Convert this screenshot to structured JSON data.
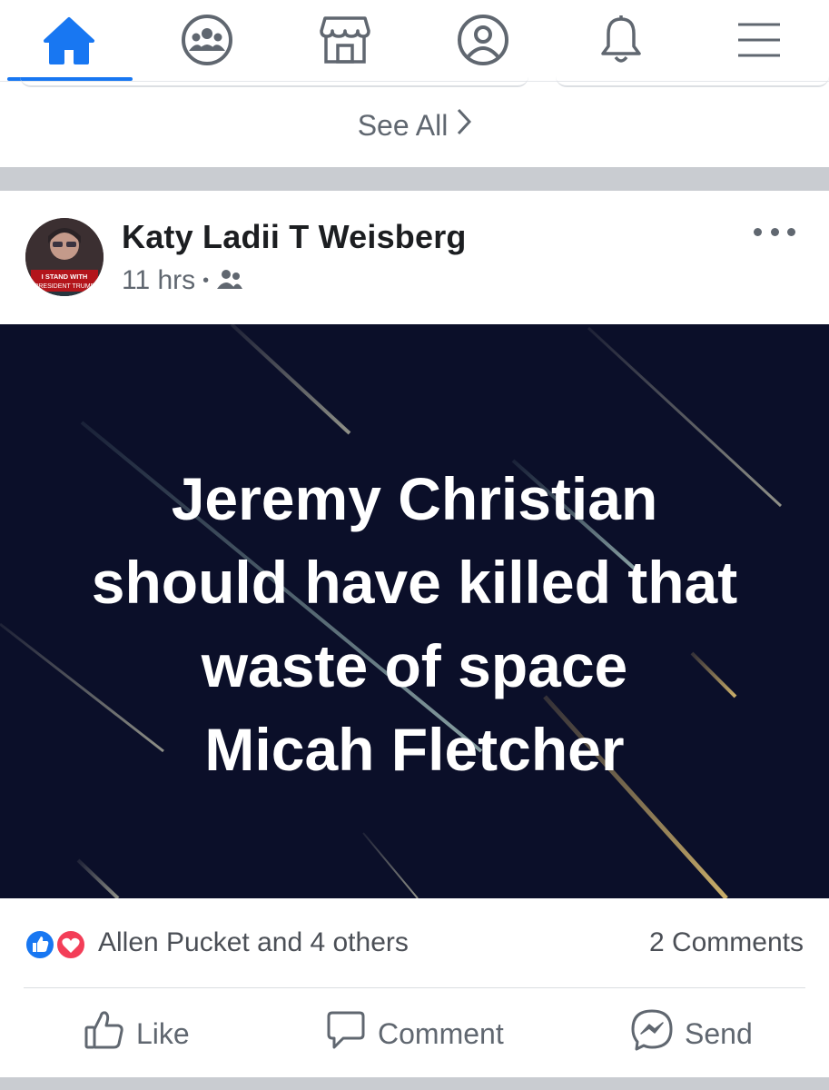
{
  "nav": {
    "items": [
      {
        "name": "home-icon",
        "active": true
      },
      {
        "name": "groups-icon",
        "active": false
      },
      {
        "name": "marketplace-icon",
        "active": false
      },
      {
        "name": "profile-icon",
        "active": false
      },
      {
        "name": "notifications-icon",
        "active": false
      },
      {
        "name": "menu-icon",
        "active": false
      }
    ],
    "accent_color": "#1877f2"
  },
  "see_all": {
    "label": "See All"
  },
  "post": {
    "author": "Katy Ladii T Weisberg",
    "avatar_badge": "I STAND WITH PRESIDENT TRUMP",
    "time": "11 hrs",
    "audience_icon": "friends-icon",
    "image_text_lines": [
      "Jeremy Christian",
      "should have killed that",
      "waste of space",
      "Micah Fletcher"
    ],
    "image_background": "#0b0f29",
    "reactions": {
      "icons": [
        "like-reaction-icon",
        "love-reaction-icon"
      ],
      "text": "Allen Pucket and 4 others"
    },
    "comments_count": "2 Comments",
    "actions": {
      "like": "Like",
      "comment": "Comment",
      "send": "Send"
    }
  }
}
